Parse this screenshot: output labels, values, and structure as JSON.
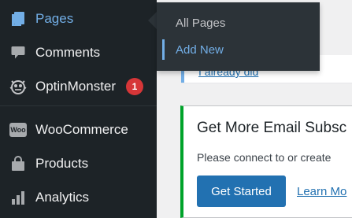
{
  "sidebar": {
    "items": [
      {
        "label": "Pages",
        "icon": "pages-icon",
        "active": true
      },
      {
        "label": "Comments",
        "icon": "comments-icon"
      },
      {
        "label": "OptinMonster",
        "icon": "optinmonster-icon",
        "badge": "1"
      },
      {
        "label": "WooCommerce",
        "icon": "woocommerce-icon",
        "icon_text": "Woo"
      },
      {
        "label": "Products",
        "icon": "products-icon"
      },
      {
        "label": "Analytics",
        "icon": "analytics-icon"
      }
    ]
  },
  "flyout": {
    "items": [
      {
        "label": "All Pages"
      },
      {
        "label": "Add New",
        "current": true
      }
    ]
  },
  "notice_top": {
    "link": "I already did"
  },
  "notice_card": {
    "title": "Get More Email Subsc",
    "description": "Please connect to or create",
    "primary_button": "Get Started",
    "secondary_link": "Learn Mo"
  },
  "colors": {
    "sidebar_bg": "#1d2327",
    "flyout_bg": "#2c3338",
    "accent_blue": "#72aee6",
    "button_blue": "#2271b1",
    "badge_red": "#d63638",
    "success_green": "#00a32a",
    "content_bg": "#f0f0f1"
  }
}
